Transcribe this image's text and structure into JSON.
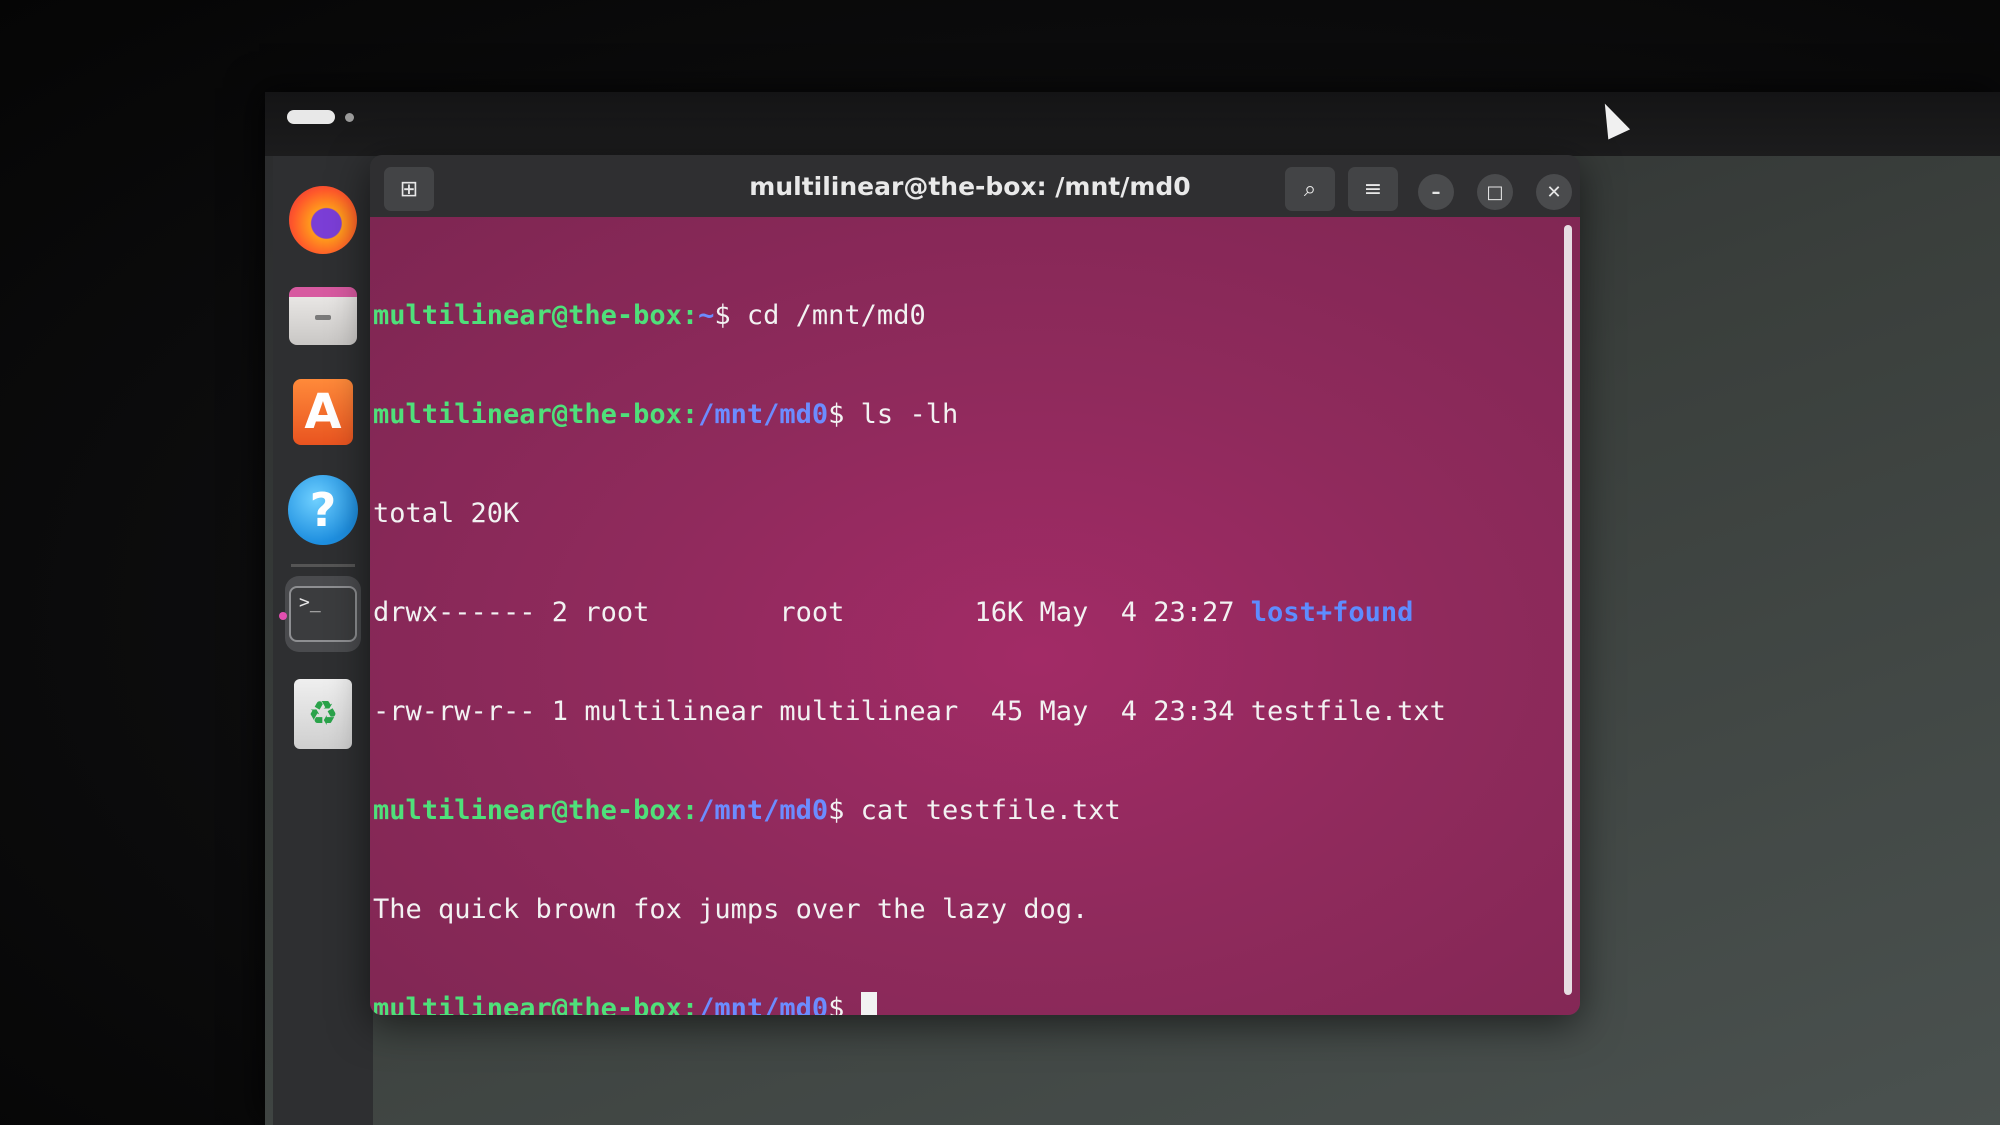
{
  "window": {
    "title": "multilinear@the-box: /mnt/md0"
  },
  "dock": {
    "items": [
      {
        "name": "Firefox"
      },
      {
        "name": "Files"
      },
      {
        "name": "App Center",
        "glyph": "A"
      },
      {
        "name": "Help",
        "glyph": "?"
      },
      {
        "name": "Terminal",
        "glyph": ">_"
      },
      {
        "name": "Trash",
        "glyph": "♻"
      }
    ]
  },
  "terminal": {
    "lines": [
      {
        "user": "multilinear@the-box:",
        "path": "~",
        "dollar": "$ ",
        "cmd": "cd /mnt/md0"
      },
      {
        "user": "multilinear@the-box:",
        "path": "/mnt/md0",
        "dollar": "$ ",
        "cmd": "ls -lh"
      },
      {
        "text": "total 20K"
      },
      {
        "text": "drwx------ 2 root        root        16K May  4 23:27 ",
        "dir": "lost+found"
      },
      {
        "text": "-rw-rw-r-- 1 multilinear multilinear  45 May  4 23:34 testfile.txt"
      },
      {
        "user": "multilinear@the-box:",
        "path": "/mnt/md0",
        "dollar": "$ ",
        "cmd": "cat testfile.txt"
      },
      {
        "text": "The quick brown fox jumps over the lazy dog."
      },
      {
        "user": "multilinear@the-box:",
        "path": "/mnt/md0",
        "dollar": "$ ",
        "cmd": ""
      }
    ]
  },
  "headerbar": {
    "new_tab_glyph": "⊞",
    "search_glyph": "⌕",
    "menu_glyph": "≡",
    "minimize_glyph": "–",
    "maximize_glyph": "□",
    "close_glyph": "✕"
  }
}
